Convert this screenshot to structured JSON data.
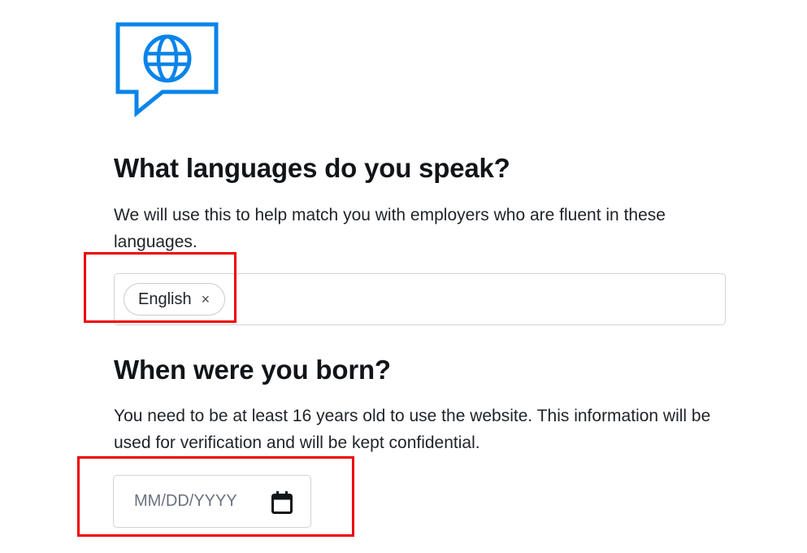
{
  "logo": {
    "icon": "globe-speech-bubble-icon",
    "color": "#0a84ea"
  },
  "languages": {
    "heading": "What languages do you speak?",
    "description": "We will use this to help match you with employers who are fluent in these languages.",
    "selected": [
      {
        "label": "English",
        "remove_glyph": "×"
      }
    ]
  },
  "birthdate": {
    "heading": "When were you born?",
    "description": "You need to be at least 16 years old to use the website. This information will be used for verification and will be kept confidential.",
    "placeholder": "MM/DD/YYYY",
    "value": "",
    "icon": "calendar-icon"
  },
  "highlight_color": "#ee0000"
}
